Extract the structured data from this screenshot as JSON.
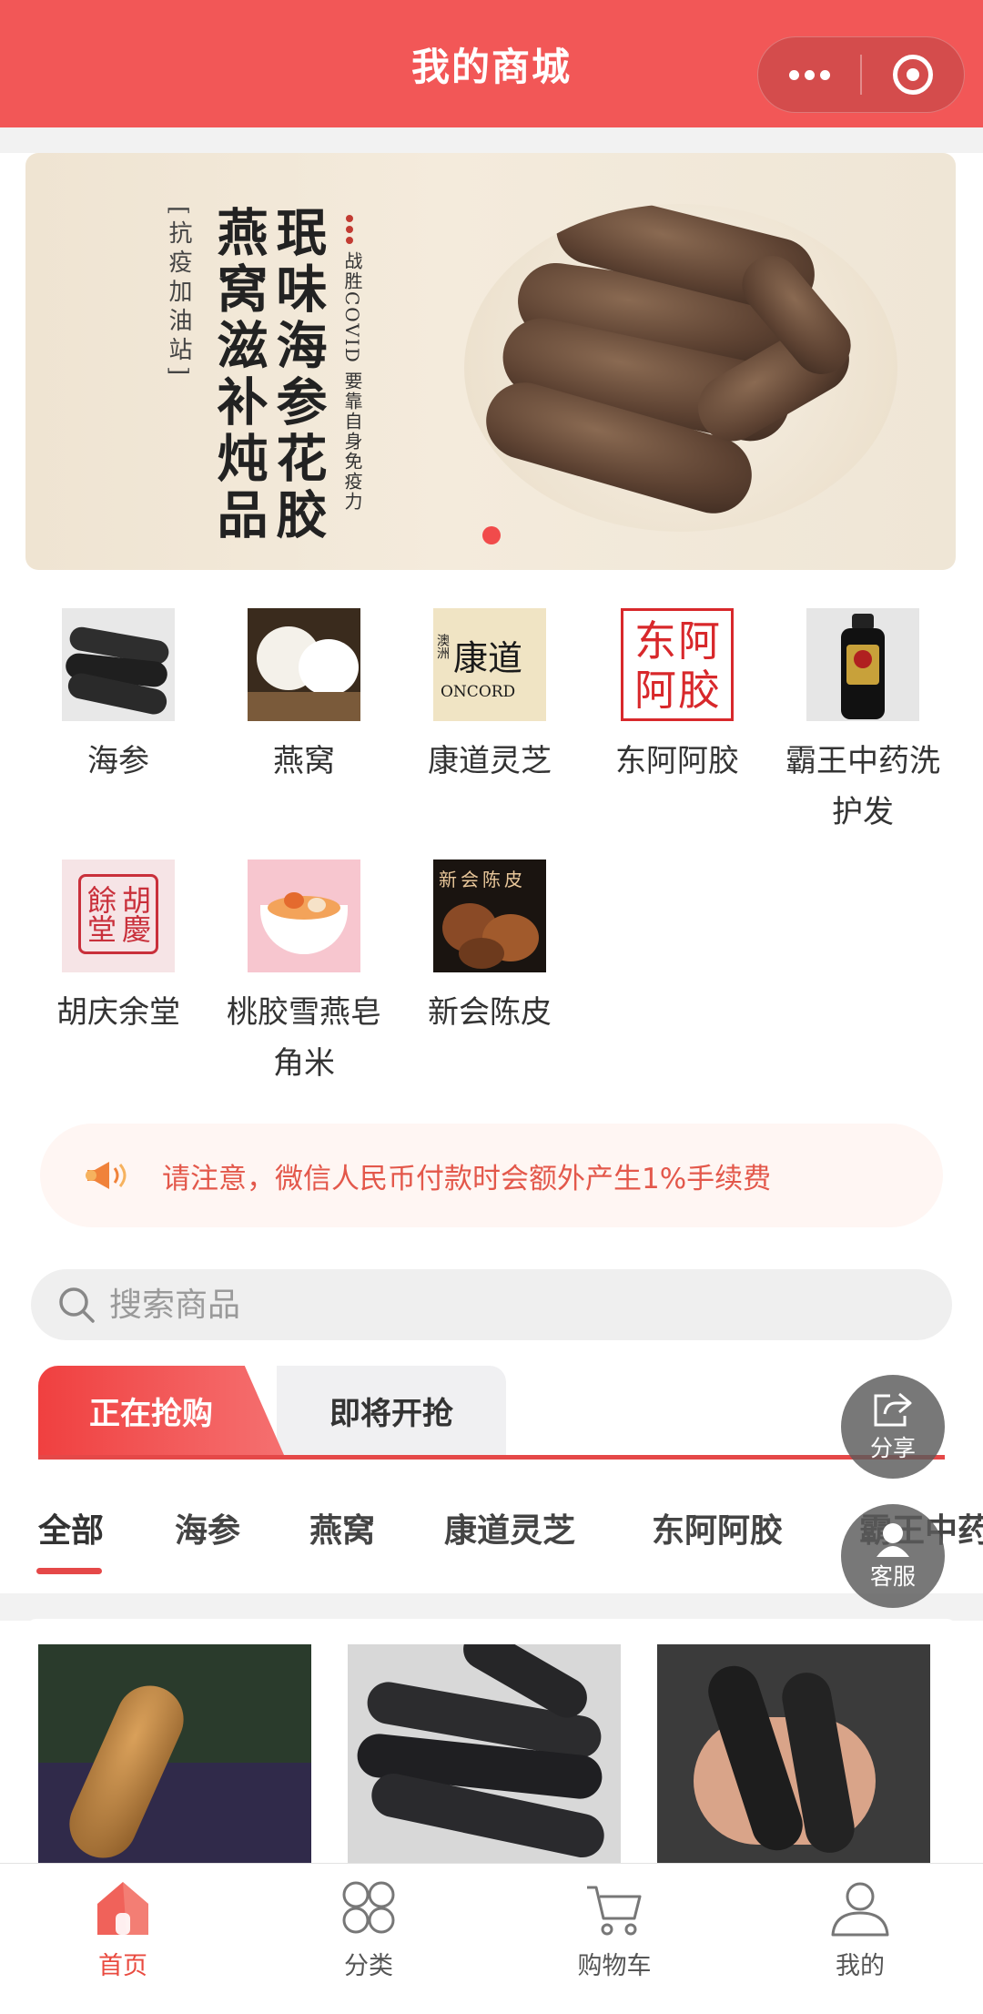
{
  "header": {
    "title": "我的商城"
  },
  "banner": {
    "vertical_lines": [
      "[抗疫加油站]",
      "燕窝滋补炖品",
      "珉味海参花胶",
      "战胜COVID 要靠自身免疫力"
    ]
  },
  "categories": [
    {
      "label": "海参",
      "icon": "sea-cucumber-thumbnail"
    },
    {
      "label": "燕窝",
      "icon": "birds-nest-thumbnail"
    },
    {
      "label": "康道灵芝",
      "icon": "concord-logo-thumbnail",
      "logo_text": "康道",
      "logo_side": "澳洲",
      "logo_sub": "ONCORD"
    },
    {
      "label": "东阿阿胶",
      "icon": "donge-ejiao-logo-thumbnail",
      "logo_text": "东阿阿胶"
    },
    {
      "label": "霸王中药洗护发",
      "icon": "bawang-shampoo-thumbnail"
    },
    {
      "label": "胡庆余堂",
      "icon": "huqingyutang-seal-thumbnail",
      "logo_text": "胡慶餘堂"
    },
    {
      "label": "桃胶雪燕皂角米",
      "icon": "peach-gum-dessert-thumbnail"
    },
    {
      "label": "新会陈皮",
      "icon": "xinhui-tangerine-peel-thumbnail",
      "logo_text": "新会陈皮"
    }
  ],
  "notice": {
    "text": "请注意，微信人民币付款时会额外产生1%手续费"
  },
  "search": {
    "placeholder": "搜索商品"
  },
  "sale_tabs": {
    "active": "正在抢购",
    "inactive": "即将开抢"
  },
  "subtabs": [
    "全部",
    "海参",
    "燕窝",
    "康道灵芝",
    "东阿阿胶",
    "霸王中药"
  ],
  "floating": {
    "share": "分享",
    "service": "客服"
  },
  "bottom_nav": [
    {
      "label": "首页",
      "icon": "home-icon",
      "active": true
    },
    {
      "label": "分类",
      "icon": "category-icon",
      "active": false
    },
    {
      "label": "购物车",
      "icon": "cart-icon",
      "active": false
    },
    {
      "label": "我的",
      "icon": "profile-icon",
      "active": false
    }
  ],
  "colors": {
    "brand": "#f25757",
    "accent": "#e54848",
    "notice_text": "#e3584b"
  }
}
